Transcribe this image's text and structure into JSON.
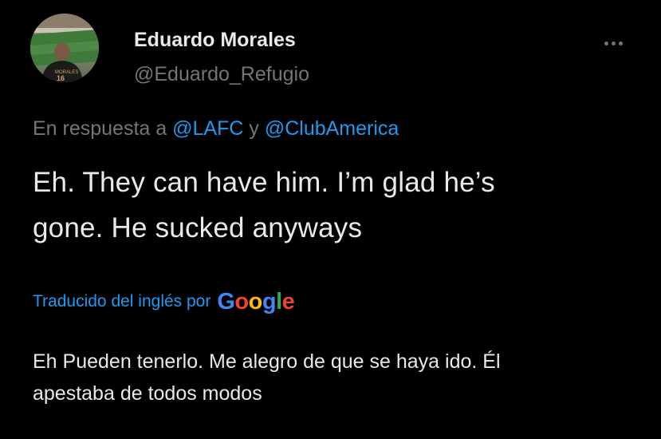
{
  "author": {
    "display_name": "Eduardo Morales",
    "handle": "@Eduardo_Refugio",
    "avatar_jersey_name": "MORALES",
    "avatar_jersey_number": "16"
  },
  "reply": {
    "prefix": "En respuesta a",
    "first_mention": "@LAFC",
    "conjunction": "y",
    "second_mention": "@ClubAmerica"
  },
  "tweet": {
    "text_line1": "Eh. They can have him. I’m glad he’s",
    "text_line2": "gone. He sucked anyways"
  },
  "translation": {
    "label": "Traducido del inglés por",
    "provider": "Google",
    "provider_letters": [
      "G",
      "o",
      "o",
      "g",
      "l",
      "e"
    ],
    "text_line1": "Eh Pueden tenerlo. Me alegro de que se haya ido. Él",
    "text_line2": "apestaba de todos modos"
  },
  "colors": {
    "background": "#000000",
    "primary_text": "#e7e9ea",
    "secondary_text": "#71767b",
    "link": "#1d9bf0",
    "google_blue": "#4285F4",
    "google_red": "#EA4335",
    "google_yellow": "#FBBC05",
    "google_green": "#34A853"
  },
  "icons": {
    "more": "more-horizontal-icon",
    "avatar": "avatar-image"
  }
}
